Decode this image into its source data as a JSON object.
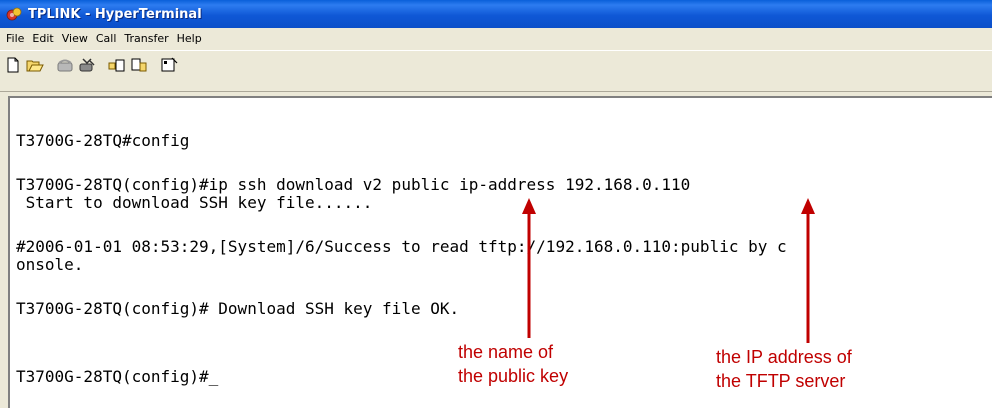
{
  "window": {
    "title": "TPLINK - HyperTerminal",
    "accent_color": "#0b4fc9",
    "icon": "hyperterminal-icon"
  },
  "menubar": {
    "items": [
      "File",
      "Edit",
      "View",
      "Call",
      "Transfer",
      "Help"
    ]
  },
  "toolbar": {
    "buttons": [
      {
        "icon": "new-document-icon"
      },
      {
        "icon": "open-folder-icon"
      },
      {
        "icon": "connect-phone-icon"
      },
      {
        "icon": "disconnect-phone-icon"
      },
      {
        "icon": "send-file-icon"
      },
      {
        "icon": "receive-file-icon"
      },
      {
        "icon": "properties-icon"
      }
    ]
  },
  "terminal": {
    "lines": [
      "T3700G-28TQ#config",
      "T3700G-28TQ(config)#ip ssh download v2 public ip-address 192.168.0.110",
      " Start to download SSH key file......",
      "#2006-01-01 08:53:29,[System]/6/Success to read tftp://192.168.0.110:public by c",
      "onsole.",
      "T3700G-28TQ(config)# Download SSH key file OK.",
      "T3700G-28TQ(config)#_"
    ]
  },
  "annotations": {
    "public_key": {
      "line1": "the name of",
      "line2": "the public key"
    },
    "tftp_server": {
      "line1": "the IP address of",
      "line2": "the TFTP server"
    },
    "color": "#c00000"
  }
}
